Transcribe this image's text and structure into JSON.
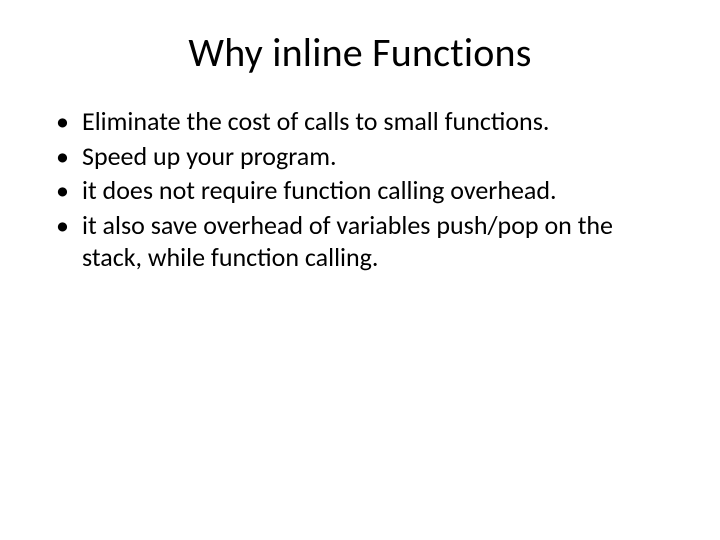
{
  "slide": {
    "title": "Why inline Functions",
    "bullets": [
      "Eliminate the cost of calls to small functions.",
      "Speed up your program.",
      "it does not require function calling overhead.",
      "it also save overhead of variables push/pop on the stack, while function calling."
    ]
  }
}
